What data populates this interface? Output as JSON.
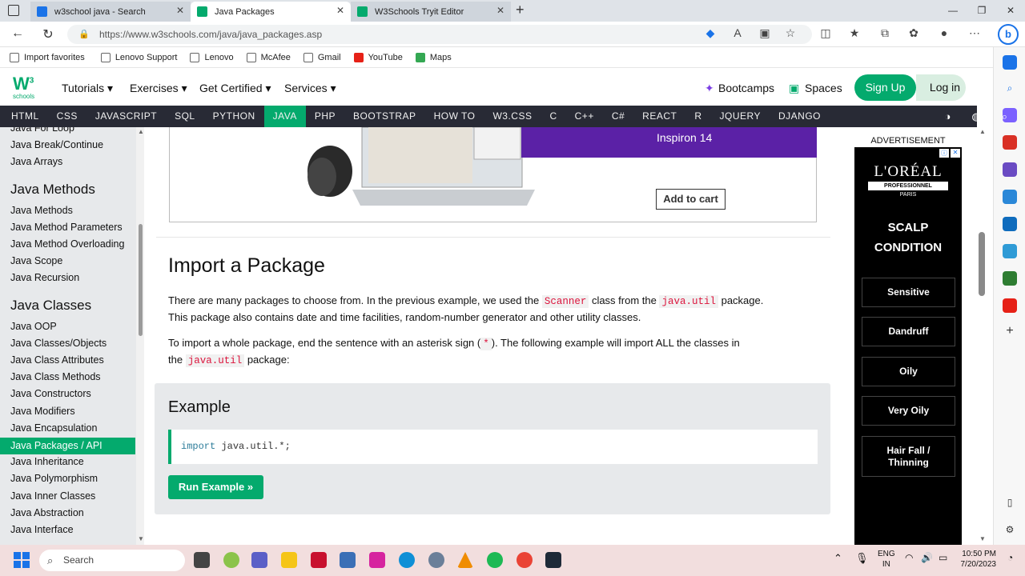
{
  "browser": {
    "tabs": [
      {
        "label": "w3school java - Search",
        "active": false
      },
      {
        "label": "Java Packages",
        "active": true
      },
      {
        "label": "W3Schools Tryit Editor",
        "active": false
      }
    ],
    "url": "https://www.w3schools.com/java/java_packages.asp",
    "bookmarks": [
      "Import favorites",
      "Lenovo Support",
      "Lenovo",
      "McAfee",
      "Gmail",
      "YouTube",
      "Maps"
    ]
  },
  "header": {
    "logo_text": "schools",
    "logo_sup": "3",
    "menus": [
      "Tutorials ▾",
      "Exercises ▾",
      "Get Certified ▾",
      "Services ▾"
    ],
    "bootcamps": "Bootcamps",
    "spaces": "Spaces",
    "signup": "Sign Up",
    "login": "Log in"
  },
  "topnav": [
    "HTML",
    "CSS",
    "JAVASCRIPT",
    "SQL",
    "PYTHON",
    "JAVA",
    "PHP",
    "BOOTSTRAP",
    "HOW TO",
    "W3.CSS",
    "C",
    "C++",
    "C#",
    "REACT",
    "R",
    "JQUERY",
    "DJANGO"
  ],
  "topnav_active": "JAVA",
  "sidebar": {
    "top_items": [
      "Java For Loop",
      "Java Break/Continue",
      "Java Arrays"
    ],
    "methods_heading": "Java Methods",
    "methods_items": [
      "Java Methods",
      "Java Method Parameters",
      "Java Method Overloading",
      "Java Scope",
      "Java Recursion"
    ],
    "classes_heading": "Java Classes",
    "classes_items": [
      "Java OOP",
      "Java Classes/Objects",
      "Java Class Attributes",
      "Java Class Methods",
      "Java Constructors",
      "Java Modifiers",
      "Java Encapsulation",
      "Java Packages / API",
      "Java Inheritance",
      "Java Polymorphism",
      "Java Inner Classes",
      "Java Abstraction",
      "Java Interface"
    ],
    "active_item": "Java Packages / API"
  },
  "ad": {
    "product": "Inspiron 14",
    "cta": "Add to cart"
  },
  "content": {
    "heading": "Import a Package",
    "p1_a": "There are many packages to choose from. In the previous example, we used the ",
    "p1_code1": "Scanner",
    "p1_b": " class from the ",
    "p1_code2": "java.util",
    "p1_c": " package.",
    "p1_line2": "This package also contains date and time facilities, random-number generator and other utility classes.",
    "p2_a": "To import a whole package, end the sentence with an asterisk sign (",
    "p2_code1": "*",
    "p2_b": "). The following example will import ALL the classes in",
    "p2_c": "the ",
    "p2_code2": "java.util",
    "p2_d": " package:",
    "example_title": "Example",
    "code_kw": "import",
    "code_rest": " java.util.*;",
    "run_button": "Run Example »"
  },
  "right_ad": {
    "label": "ADVERTISEMENT",
    "brand": "L'ORÉAL",
    "sub": "PROFESSIONNEL",
    "city": "PARIS",
    "title_line1": "SCALP",
    "title_line2": "CONDITION",
    "options": [
      "Sensitive",
      "Dandruff",
      "Oily",
      "Very Oily",
      "Hair Fall / Thinning"
    ]
  },
  "taskbar": {
    "search": "Search",
    "lang1": "ENG",
    "lang2": "IN",
    "time": "10:50 PM",
    "date": "7/20/2023"
  }
}
